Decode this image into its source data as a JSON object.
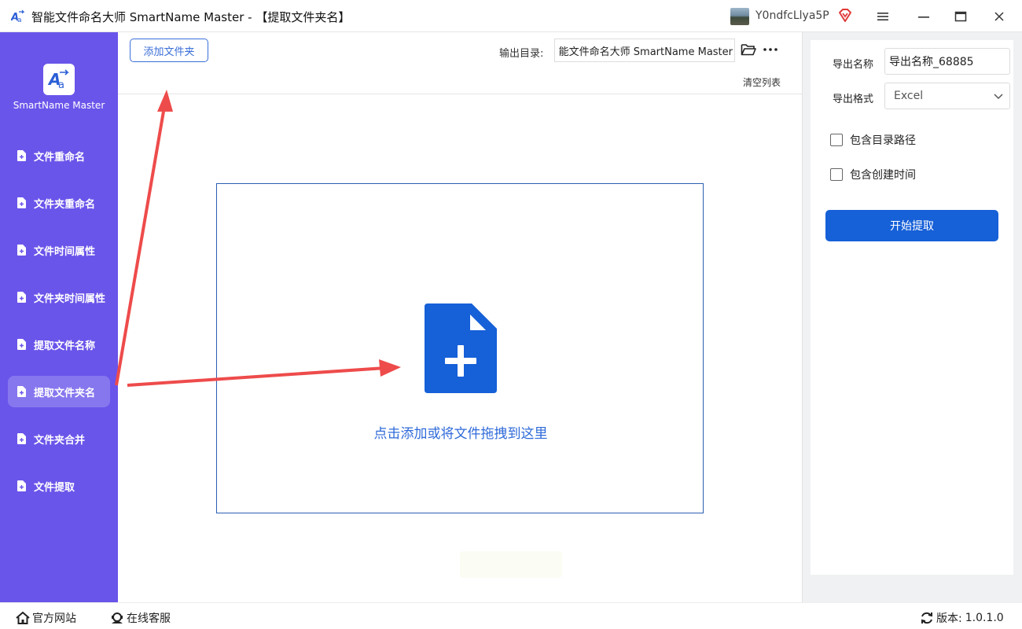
{
  "window": {
    "title": "智能文件命名大师 SmartName Master - 【提取文件夹名】",
    "user_name": "Y0ndfcLlya5P"
  },
  "sidebar": {
    "logo_label": "SmartName Master",
    "items": [
      {
        "label": "文件重命名"
      },
      {
        "label": "文件夹重命名"
      },
      {
        "label": "文件时间属性"
      },
      {
        "label": "文件夹时间属性"
      },
      {
        "label": "提取文件名称"
      },
      {
        "label": "提取文件夹名",
        "active": true
      },
      {
        "label": "文件夹合并"
      },
      {
        "label": "文件提取"
      }
    ]
  },
  "toolbar": {
    "add_folder_label": "添加文件夹",
    "output_dir_label": "输出目录:",
    "output_dir_value": "能文件命名大师 SmartName Master",
    "clear_list_label": "清空列表"
  },
  "dropzone": {
    "hint": "点击添加或将文件拖拽到这里"
  },
  "settings": {
    "export_name_label": "导出名称",
    "export_name_value": "导出名称_68885",
    "export_format_label": "导出格式",
    "export_format_value": "Excel",
    "include_path_label": "包含目录路径",
    "include_path_checked": false,
    "include_ctime_label": "包含创建时间",
    "include_ctime_checked": false,
    "start_label": "开始提取"
  },
  "footer": {
    "website_label": "官方网站",
    "support_label": "在线客服",
    "version_label": "版本:",
    "version_value": "1.0.1.0"
  },
  "colors": {
    "sidebar": "#6a55ea",
    "primary": "#1660d8",
    "annotation_arrow": "#ee4b4b"
  }
}
